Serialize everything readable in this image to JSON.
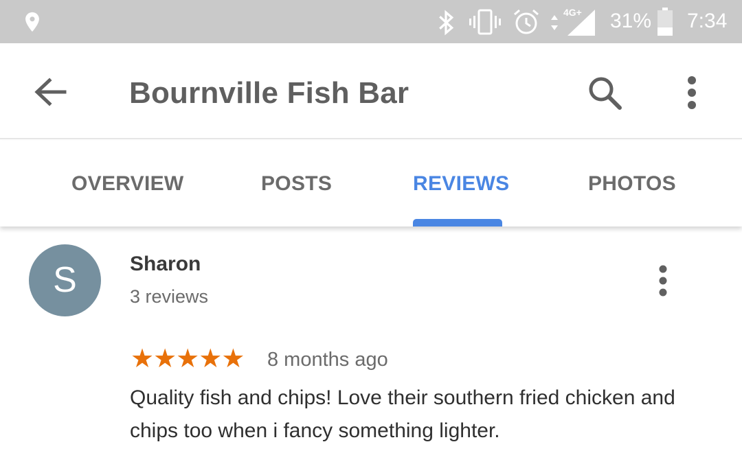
{
  "status_bar": {
    "battery_percent": "31%",
    "time": "7:34",
    "network_label": "4G+",
    "icons": [
      "location-icon",
      "bluetooth-icon",
      "vibrate-icon",
      "alarm-icon",
      "data-arrows-icon",
      "signal-icon",
      "battery-icon"
    ]
  },
  "app_bar": {
    "title": "Bournville Fish Bar",
    "icons": [
      "back-arrow-icon",
      "search-icon",
      "more-vert-icon"
    ]
  },
  "tabs": [
    {
      "label": "OVERVIEW",
      "active": false
    },
    {
      "label": "POSTS",
      "active": false
    },
    {
      "label": "REVIEWS",
      "active": true
    },
    {
      "label": "PHOTOS",
      "active": false
    }
  ],
  "review": {
    "avatar_letter": "S",
    "reviewer_name": "Sharon",
    "reviewer_count": "3 reviews",
    "rating": 5,
    "rating_max": 5,
    "time": "8 months ago",
    "text": "Quality fish and chips! Love their southern fried chicken and chips too when i fancy something lighter."
  },
  "colors": {
    "status_bar": "#c9c9c9",
    "accent": "#4a86e3",
    "star": "#e8710a",
    "avatar": "#76909f"
  }
}
